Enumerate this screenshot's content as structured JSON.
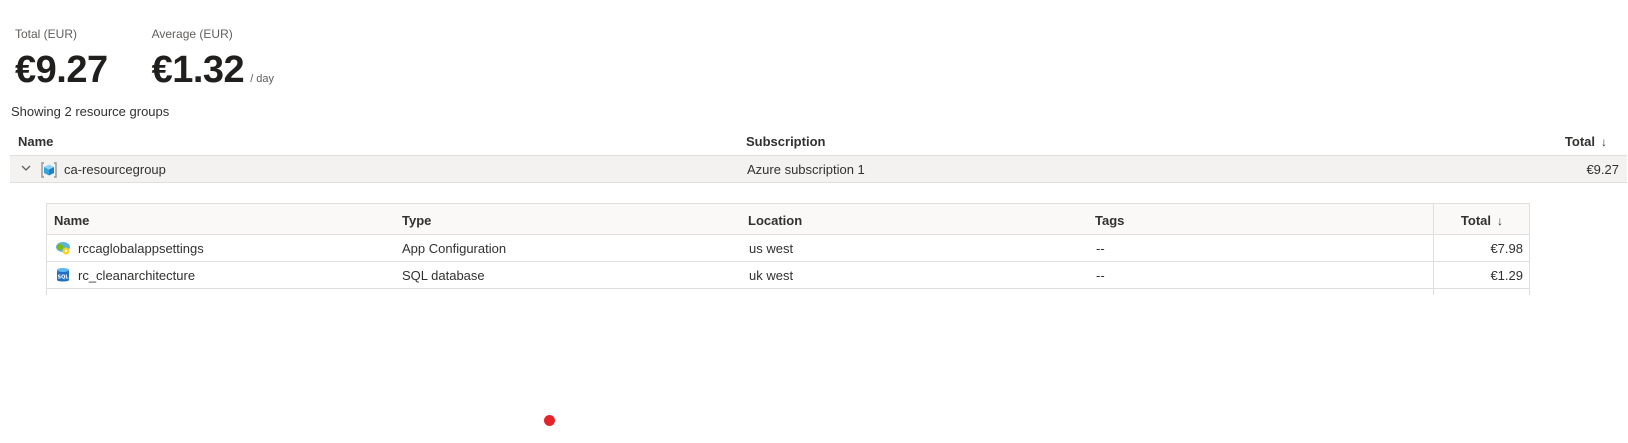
{
  "summary": {
    "total_label": "Total (EUR)",
    "total_value": "€9.27",
    "average_label": "Average (EUR)",
    "average_value": "€1.32",
    "average_unit": "/ day"
  },
  "showing_text": "Showing 2 resource groups",
  "outer_grid": {
    "columns": {
      "name": "Name",
      "subscription": "Subscription",
      "total": "Total"
    },
    "sort_icon": "arrow-down-icon",
    "rows": [
      {
        "expand_icon": "chevron-down-icon",
        "icon": "resource-group-icon",
        "name": "ca-resourcegroup",
        "subscription": "Azure subscription 1",
        "total": "€9.27"
      }
    ]
  },
  "inner_grid": {
    "columns": {
      "name": "Name",
      "type": "Type",
      "location": "Location",
      "tags": "Tags",
      "total": "Total"
    },
    "sort_icon": "arrow-down-icon",
    "rows": [
      {
        "icon": "app-configuration-icon",
        "name": "rccaglobalappsettings",
        "type": "App Configuration",
        "location": "us west",
        "tags": "--",
        "total": "€7.98"
      },
      {
        "icon": "sql-database-icon",
        "name": "rc_cleanarchitecture",
        "type": "SQL database",
        "location": "uk west",
        "tags": "--",
        "total": "€1.29"
      }
    ]
  },
  "colors": {
    "row_highlight": "#f3f2f1",
    "border": "#e1dfdd",
    "cursor_dot": "#e3242b"
  }
}
